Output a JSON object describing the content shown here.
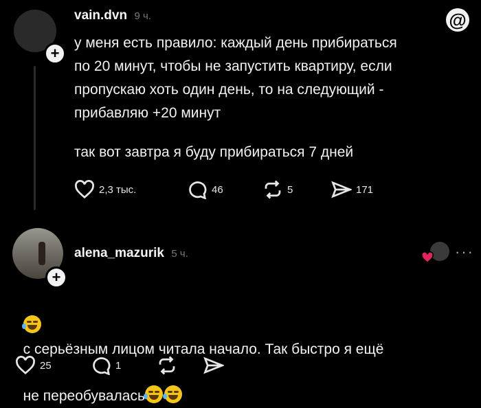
{
  "post": {
    "username": "vain.dvn",
    "time": "9 ч.",
    "paragraph1": "у меня есть правило: каждый день прибираться\nпо 20 минут, чтобы не запустить квартиру, если\nпропускаю хоть один день, то на следующий -\nприбавляю +20 минут",
    "paragraph2": "так вот завтра я буду прибираться 7 дней",
    "likes": "2,3 тыс.",
    "comments": "46",
    "reposts": "5",
    "shares": "171"
  },
  "reply": {
    "username": "alena_mazurik",
    "time": "5 ч.",
    "text_line1": "с серьёзным лицом читала начало. Так быстро я ещё",
    "text_line2": "не переобувалась",
    "likes": "25",
    "comments": "1",
    "more": "···"
  },
  "icons": {
    "brand": "threads-logo",
    "like": "heart-icon",
    "comment": "comment-bubble-icon",
    "repost": "repost-icon",
    "share": "send-icon",
    "follow": "plus-icon",
    "emoji": "rolling-on-floor-laughing-emoji"
  },
  "colors": {
    "background": "#000000",
    "text": "#f2f2f2",
    "muted": "#7a7a7a",
    "heart_red": "#e0245e"
  }
}
